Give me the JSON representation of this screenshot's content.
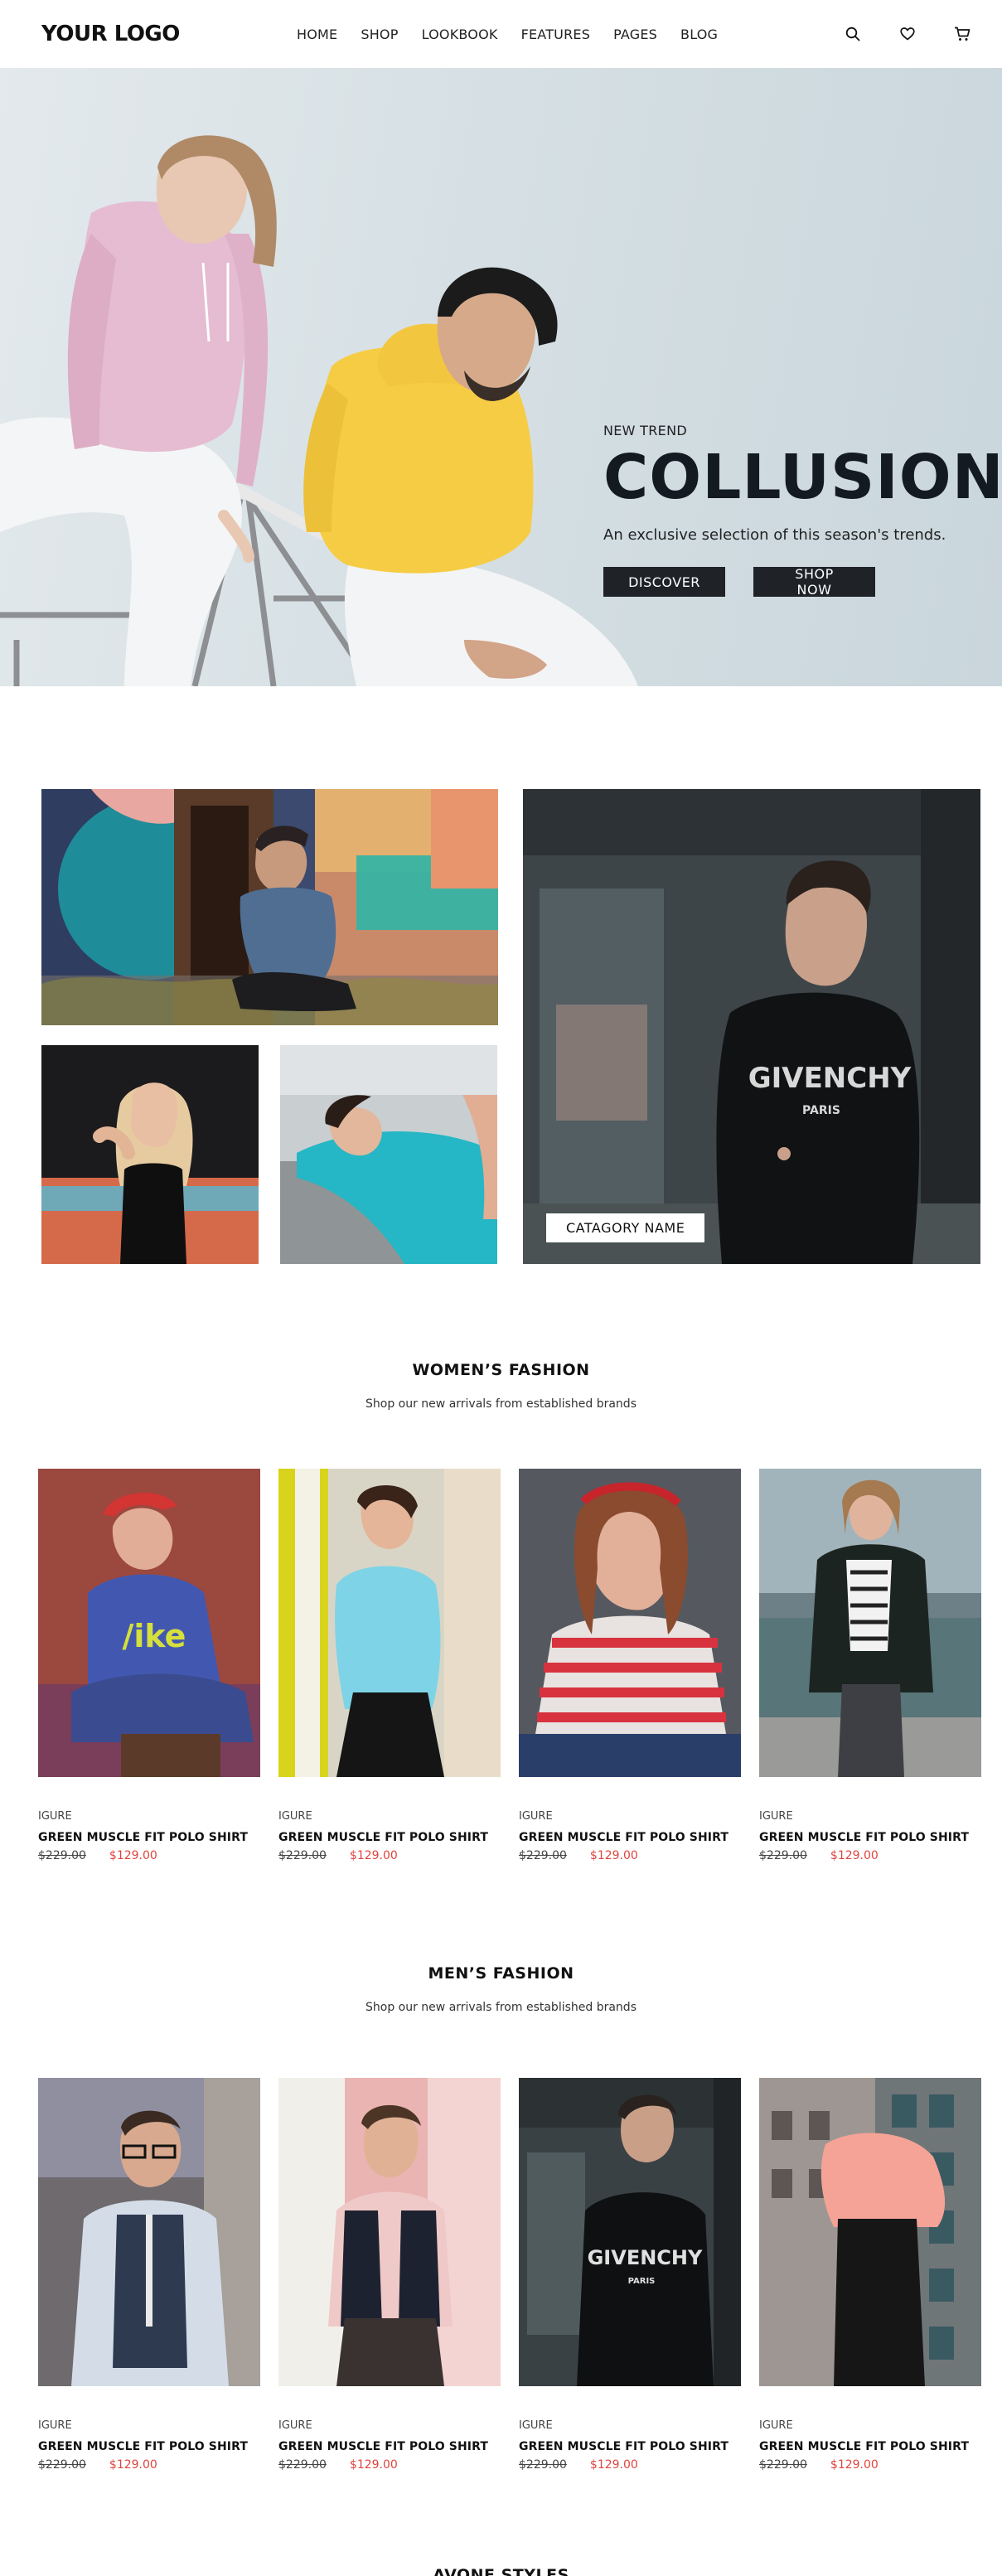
{
  "header": {
    "logo": "YOUR LOGO",
    "nav": [
      "HOME",
      "SHOP",
      "LOOKBOOK",
      "FEATURES",
      "PAGES",
      "BLOG"
    ],
    "icons": [
      "search-icon",
      "heart-icon",
      "cart-icon"
    ]
  },
  "hero": {
    "kicker": "NEW TREND",
    "title": "COLLUSION",
    "subtitle": "An exclusive selection of this season's trends.",
    "discover_label": "DISCOVER",
    "shop_label": "SHOP NOW"
  },
  "categories": {
    "label": "CATAGORY NAME"
  },
  "womens": {
    "title": "WOMEN’S FASHION",
    "subtitle": "Shop our new arrivals from established brands",
    "products": [
      {
        "brand": "IGURE",
        "name": "GREEN MUSCLE FIT POLO SHIRT",
        "old_price": "$229.00",
        "price": "$129.00"
      },
      {
        "brand": "IGURE",
        "name": "GREEN MUSCLE FIT POLO SHIRT",
        "old_price": "$229.00",
        "price": "$129.00"
      },
      {
        "brand": "IGURE",
        "name": "GREEN MUSCLE FIT POLO SHIRT",
        "old_price": "$229.00",
        "price": "$129.00"
      },
      {
        "brand": "IGURE",
        "name": "GREEN MUSCLE FIT POLO SHIRT",
        "old_price": "$229.00",
        "price": "$129.00"
      }
    ]
  },
  "mens": {
    "title": "MEN’S FASHION",
    "subtitle": "Shop our new arrivals from established brands",
    "products": [
      {
        "brand": "IGURE",
        "name": "GREEN MUSCLE FIT POLO SHIRT",
        "old_price": "$229.00",
        "price": "$129.00"
      },
      {
        "brand": "IGURE",
        "name": "GREEN MUSCLE FIT POLO SHIRT",
        "old_price": "$229.00",
        "price": "$129.00"
      },
      {
        "brand": "IGURE",
        "name": "GREEN MUSCLE FIT POLO SHIRT",
        "old_price": "$229.00",
        "price": "$129.00"
      },
      {
        "brand": "IGURE",
        "name": "GREEN MUSCLE FIT POLO SHIRT",
        "old_price": "$229.00",
        "price": "$129.00"
      }
    ]
  },
  "footer_section": {
    "title": "AVONE STYLES"
  },
  "colors": {
    "accent_price": "#e0443e",
    "button_dark": "#1f2328",
    "hero_bg": "#d6e0e4"
  }
}
